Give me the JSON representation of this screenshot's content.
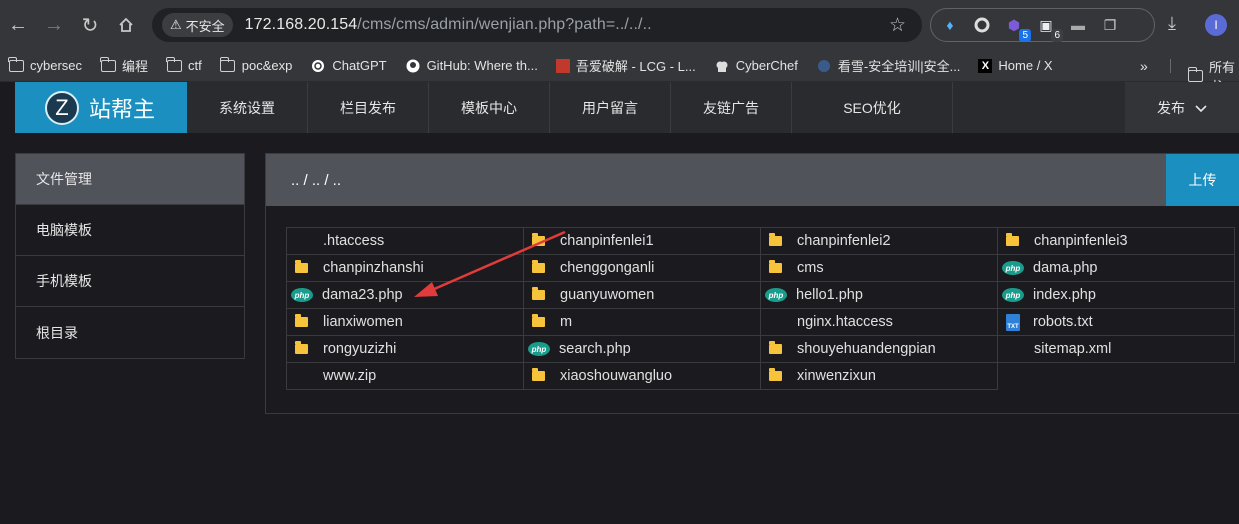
{
  "browser": {
    "security_label": "不安全",
    "url_host": "172.168.20.154",
    "url_path": "/cms/cms/admin/wenjian.php?path=../../..",
    "extensions": [
      {
        "icon": "diamond-extension-icon"
      },
      {
        "icon": "circle-extension-icon"
      },
      {
        "icon": "purple-extension-icon",
        "badge": "5"
      },
      {
        "icon": "dice-extension-icon",
        "badge": "6"
      },
      {
        "icon": "hat-extension-icon"
      },
      {
        "icon": "puzzle-icon"
      }
    ],
    "profile_initial": "I"
  },
  "bookmarks": {
    "items": [
      {
        "label": "cybersec",
        "icon": "folder"
      },
      {
        "label": "编程",
        "icon": "folder"
      },
      {
        "label": "ctf",
        "icon": "folder"
      },
      {
        "label": "poc&exp",
        "icon": "folder"
      },
      {
        "label": "ChatGPT",
        "icon": "chatgpt"
      },
      {
        "label": "GitHub: Where th...",
        "icon": "github"
      },
      {
        "label": "吾爱破解 - LCG - L...",
        "icon": "52pojie"
      },
      {
        "label": "CyberChef",
        "icon": "cyberchef"
      },
      {
        "label": "看雪-安全培训|安全...",
        "icon": "kanxue"
      },
      {
        "label": "Home / X",
        "icon": "x"
      }
    ],
    "more": "»",
    "other_label": "所有书"
  },
  "site": {
    "brand_letter": "Z",
    "brand_name": "站帮主",
    "menu": [
      "系统设置",
      "栏目发布",
      "模板中心",
      "用户留言",
      "友链广告",
      "SEO优化"
    ],
    "publish_label": "发布",
    "sidebar": [
      "文件管理",
      "电脑模板",
      "手机模板",
      "根目录"
    ],
    "path": ".. / .. / ..",
    "upload_label": "上传",
    "files": [
      {
        "name": ".htaccess",
        "type": "blank"
      },
      {
        "name": "chanpinfenlei1",
        "type": "folder"
      },
      {
        "name": "chanpinfenlei2",
        "type": "folder"
      },
      {
        "name": "chanpinfenlei3",
        "type": "folder"
      },
      {
        "name": "chanpinzhanshi",
        "type": "folder"
      },
      {
        "name": "chenggonganli",
        "type": "folder"
      },
      {
        "name": "cms",
        "type": "folder"
      },
      {
        "name": "dama.php",
        "type": "php"
      },
      {
        "name": "dama23.php",
        "type": "php"
      },
      {
        "name": "guanyuwomen",
        "type": "folder"
      },
      {
        "name": "hello1.php",
        "type": "php"
      },
      {
        "name": "index.php",
        "type": "php"
      },
      {
        "name": "lianxiwomen",
        "type": "folder"
      },
      {
        "name": "m",
        "type": "folder"
      },
      {
        "name": "nginx.htaccess",
        "type": "blank"
      },
      {
        "name": "robots.txt",
        "type": "txt"
      },
      {
        "name": "rongyuzizhi",
        "type": "folder"
      },
      {
        "name": "search.php",
        "type": "php"
      },
      {
        "name": "shouyehuandengpian",
        "type": "folder"
      },
      {
        "name": "sitemap.xml",
        "type": "blank"
      },
      {
        "name": "www.zip",
        "type": "blank"
      },
      {
        "name": "xiaoshouwangluo",
        "type": "folder"
      },
      {
        "name": "xinwenzixun",
        "type": "folder"
      }
    ]
  },
  "colors": {
    "accent": "#1a8fc0",
    "annotation_arrow": "#e23b3b",
    "folder": "#f7c33b",
    "php": "#1a9c8c"
  }
}
